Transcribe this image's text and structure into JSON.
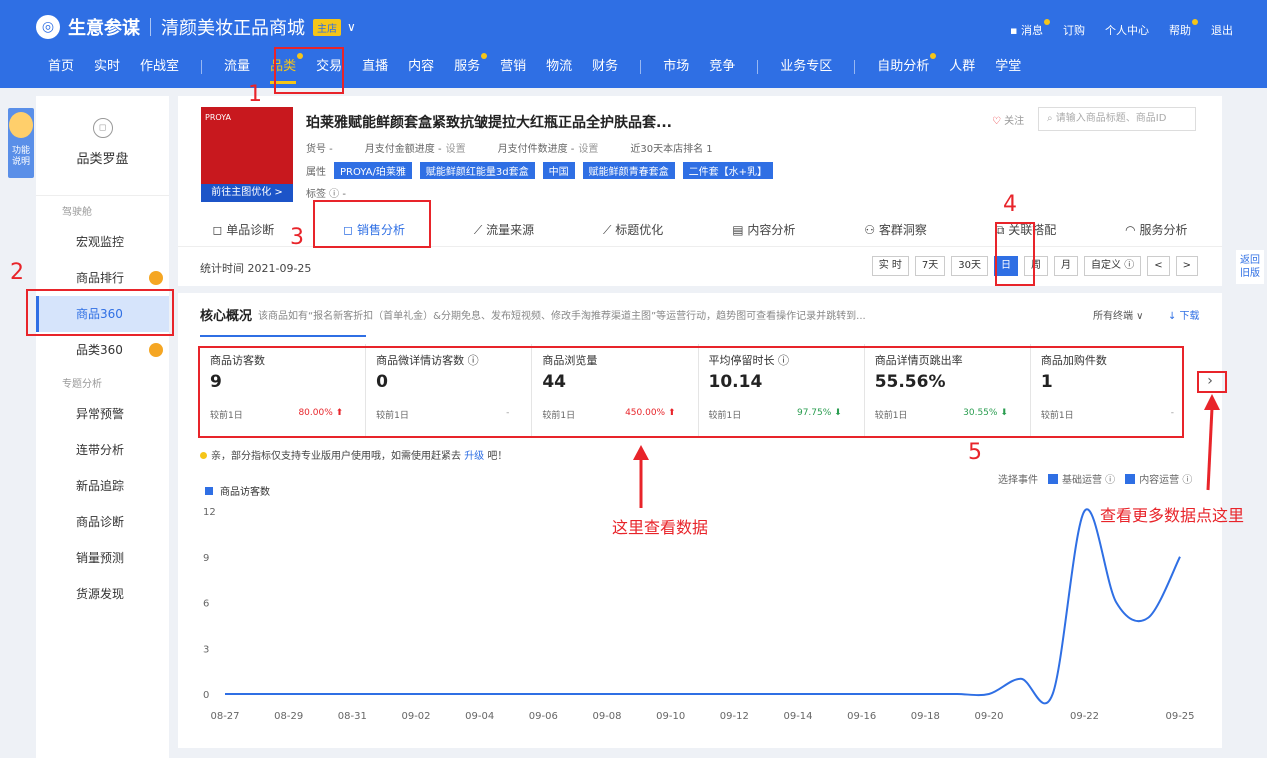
{
  "header": {
    "logo": "生意参谋",
    "shop": "清颜美妆正品商城",
    "shop_badge": "主店",
    "links": [
      "消息",
      "订购",
      "个人中心",
      "帮助",
      "退出"
    ]
  },
  "nav": [
    "首页",
    "实时",
    "作战室",
    "流量",
    "品类",
    "交易",
    "直播",
    "内容",
    "服务",
    "营销",
    "物流",
    "财务",
    "市场",
    "竞争",
    "业务专区",
    "自助分析",
    "人群",
    "学堂"
  ],
  "nav_active": "品类",
  "sidebar": {
    "title": "品类罗盘",
    "sec1": "驾驶舱",
    "items1": [
      "宏观监控",
      "商品排行",
      "商品360",
      "品类360"
    ],
    "sec2": "专题分析",
    "items2": [
      "异常预警",
      "连带分析",
      "新品追踪",
      "商品诊断",
      "销量预测",
      "货源发现"
    ],
    "active": "商品360"
  },
  "func_tab": "功能说明",
  "back_old": "返回旧版",
  "product": {
    "title": "珀莱雅赋能鲜颜套盒紧致抗皱提拉大红瓶正品全护肤品套...",
    "brand_on_img": "PROYA",
    "btn": "前往主图优化 >",
    "item_no": "货号 -",
    "pay_amount": "月支付金额进度 -",
    "pay_count": "月支付件数进度 -",
    "set_label": "设置",
    "rank": "近30天本店排名 1",
    "attr_label": "属性",
    "attrs": [
      "PROYA/珀莱雅",
      "赋能鲜颜红能量3d套盒",
      "中国",
      "赋能鲜颜青春套盒",
      "二件套【水+乳】"
    ],
    "tag_label": "标签 ⓘ  -",
    "follow": "关注",
    "search_ph": "请输入商品标题、商品ID"
  },
  "tabs": [
    "单品诊断",
    "销售分析",
    "流量来源",
    "标题优化",
    "内容分析",
    "客群洞察",
    "关联搭配",
    "服务分析"
  ],
  "tab_icons": [
    "bag-icon",
    "bag-icon",
    "trend-icon",
    "trend-icon",
    "doc-icon",
    "people-icon",
    "link-icon",
    "headset-icon"
  ],
  "tab_active": "销售分析",
  "stat_time": "统计时间 2021-09-25",
  "date_btns": [
    "实 时",
    "7天",
    "30天",
    "日",
    "周",
    "月",
    "自定义 ⓘ",
    "<",
    ">"
  ],
  "date_active": "日",
  "core": {
    "title": "核心概况",
    "subtitle": "该商品如有“报名新客折扣（首单礼金）&分期免息、发布短视频、修改手淘推荐渠道主图”等运营行动，趋势图可查看操作记录并跳转到...",
    "terminal": "所有终端 ∨",
    "download": "↓ 下载"
  },
  "metrics": [
    {
      "label": "商品访客数",
      "value": "9",
      "cmp": "较前1日",
      "change": "80.00% ⬆",
      "dir": "up"
    },
    {
      "label": "商品微详情访客数 ⓘ",
      "value": "0",
      "cmp": "较前1日",
      "change": "-",
      "dir": "na"
    },
    {
      "label": "商品浏览量",
      "value": "44",
      "cmp": "较前1日",
      "change": "450.00% ⬆",
      "dir": "up"
    },
    {
      "label": "平均停留时长 ⓘ",
      "value": "10.14",
      "cmp": "较前1日",
      "change": "97.75% ⬇",
      "dir": "down"
    },
    {
      "label": "商品详情页跳出率",
      "value": "55.56%",
      "cmp": "较前1日",
      "change": "30.55% ⬇",
      "dir": "down"
    },
    {
      "label": "商品加购件数",
      "value": "1",
      "cmp": "较前1日",
      "change": "-",
      "dir": "na"
    }
  ],
  "tip": {
    "text": "亲，部分指标仅支持专业版用户使用哦，如需使用赶紧去",
    "link": "升级",
    "tail": "吧！"
  },
  "events": {
    "label": "选择事件",
    "e1": "基础运营 ⓘ",
    "e2": "内容运营 ⓘ"
  },
  "annotations": {
    "n1": "1",
    "n2": "2",
    "n3": "3",
    "n4": "4",
    "n5": "5",
    "view_data": "这里查看数据",
    "more_points": "查看更多数据点这里"
  },
  "colors": {
    "brand": "#2f6fe4",
    "accent": "#f5c518",
    "annotation": "#e8242a"
  },
  "chart_data": {
    "type": "line",
    "series": [
      {
        "name": "商品访客数",
        "values": [
          0,
          0,
          0,
          0,
          0,
          0,
          0,
          0,
          0,
          0,
          0,
          0,
          0,
          0,
          0,
          0,
          0,
          0,
          0,
          0,
          0,
          0,
          0,
          0,
          0,
          1,
          0,
          12,
          6,
          5,
          9
        ]
      }
    ],
    "x": [
      "08-27",
      "08-28",
      "08-29",
      "08-30",
      "08-31",
      "09-01",
      "09-02",
      "09-03",
      "09-04",
      "09-05",
      "09-06",
      "09-07",
      "09-08",
      "09-09",
      "09-10",
      "09-11",
      "09-12",
      "09-13",
      "09-14",
      "09-15",
      "09-16",
      "09-17",
      "09-18",
      "09-19",
      "09-20",
      "09-20b",
      "09-21",
      "09-22",
      "09-23",
      "09-24",
      "09-25"
    ],
    "x_ticks": [
      "08-27",
      "08-29",
      "08-31",
      "09-02",
      "09-04",
      "09-06",
      "09-08",
      "09-10",
      "09-12",
      "09-14",
      "09-16",
      "09-18",
      "09-20",
      "09-22",
      "09-25"
    ],
    "y_ticks": [
      0,
      3,
      6,
      9,
      12
    ],
    "ylim": [
      0,
      12
    ],
    "color": "#2f6fe4"
  }
}
